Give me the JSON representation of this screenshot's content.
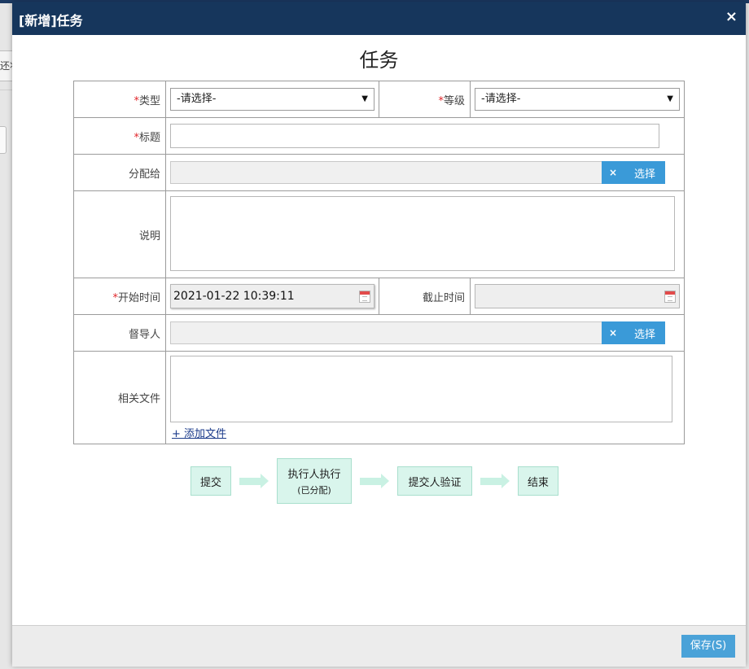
{
  "background": {
    "partial_text": "还状"
  },
  "dialog": {
    "title": "[新增]任务",
    "close_symbol": "×"
  },
  "form": {
    "heading": "任务",
    "required_marker": "*",
    "type": {
      "label": "类型",
      "value": "-请选择-"
    },
    "level": {
      "label": "等级",
      "value": "-请选择-"
    },
    "title_field": {
      "label": "标题",
      "value": ""
    },
    "assign_to": {
      "label": "分配给",
      "clear": "×",
      "pick": "选择"
    },
    "description": {
      "label": "说明",
      "value": ""
    },
    "start_time": {
      "label": "开始时间",
      "value": "2021-01-22 10:39:11"
    },
    "deadline": {
      "label": "截止时间",
      "value": ""
    },
    "supervisor": {
      "label": "督导人",
      "clear": "×",
      "pick": "选择"
    },
    "files": {
      "label": "相关文件",
      "add_link": "+ 添加文件"
    }
  },
  "flow": {
    "steps": [
      {
        "label": "提交"
      },
      {
        "label": "执行人执行",
        "sub": "(已分配)"
      },
      {
        "label": "提交人验证"
      },
      {
        "label": "结束"
      }
    ]
  },
  "footer": {
    "save_label": "保存(S)"
  },
  "colors": {
    "titlebar": "#16365c",
    "accent": "#3a9ad8",
    "flow_fill": "#d9f5ec",
    "required": "#e0262a"
  }
}
